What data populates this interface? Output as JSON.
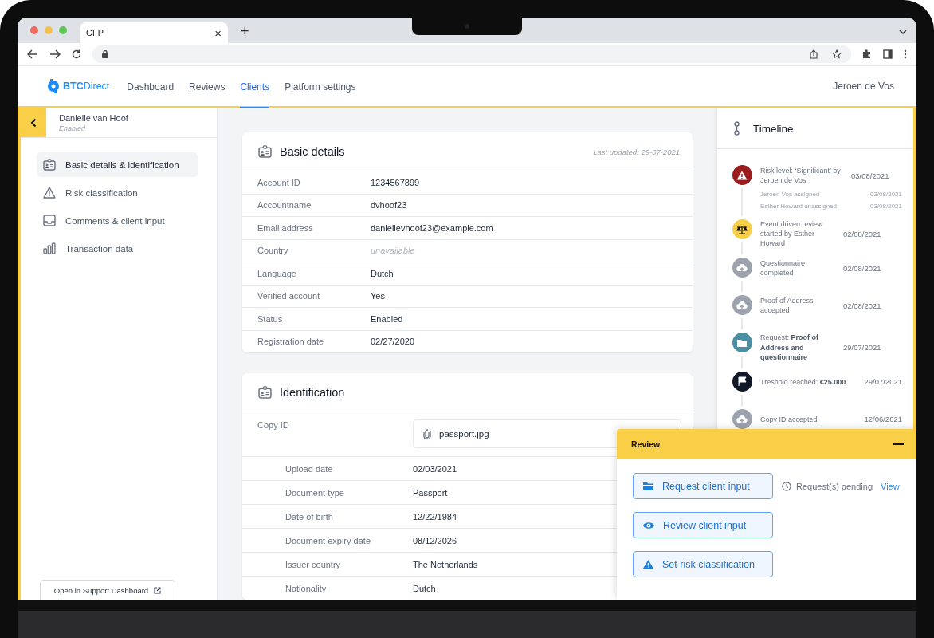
{
  "browser": {
    "tab_title": "CFP",
    "close_glyph": "×",
    "new_tab_glyph": "+"
  },
  "nav": {
    "brand": "BTC",
    "brand_suffix": "Direct",
    "user": "Jeroen de Vos",
    "items": [
      {
        "label": "Dashboard",
        "selected": false
      },
      {
        "label": "Reviews",
        "selected": false
      },
      {
        "label": "Clients",
        "selected": true
      },
      {
        "label": "Platform settings",
        "selected": false
      }
    ]
  },
  "client": {
    "name": "Danielle van Hoof",
    "status": "Enabled"
  },
  "sidebar": {
    "items": [
      {
        "label": "Basic details & identification",
        "selected": true
      },
      {
        "label": "Risk classification",
        "selected": false
      },
      {
        "label": "Comments & client input",
        "selected": false
      },
      {
        "label": "Transaction data",
        "selected": false
      }
    ],
    "support_link": "Open in Support Dashboard"
  },
  "basic_details": {
    "title": "Basic details",
    "last_updated": "Last updated: 29-07-2021",
    "rows": [
      {
        "label": "Account ID",
        "value": "1234567899",
        "unavailable": false
      },
      {
        "label": "Accountname",
        "value": "dvhoof23",
        "unavailable": false
      },
      {
        "label": "Email address",
        "value": "daniellevhoof23@example.com",
        "unavailable": false
      },
      {
        "label": "Country",
        "value": "unavailable",
        "unavailable": true
      },
      {
        "label": "Language",
        "value": "Dutch",
        "unavailable": false
      },
      {
        "label": "Verified account",
        "value": "Yes",
        "unavailable": false
      },
      {
        "label": "Status",
        "value": "Enabled",
        "unavailable": false
      },
      {
        "label": "Registration date",
        "value": "02/27/2020",
        "unavailable": false
      }
    ]
  },
  "identification": {
    "title": "Identification",
    "file_label": "Copy ID",
    "file_name": "passport.jpg",
    "rows": [
      {
        "label": "Upload date",
        "value": "02/03/2021"
      },
      {
        "label": "Document type",
        "value": "Passport"
      },
      {
        "label": "Date of birth",
        "value": "12/22/1984"
      },
      {
        "label": "Document expiry date",
        "value": "08/12/2026"
      },
      {
        "label": "Issuer country",
        "value": "The Netherlands"
      },
      {
        "label": "Nationality",
        "value": "Dutch"
      }
    ]
  },
  "timeline": {
    "title": "Timeline",
    "events": [
      {
        "kind": "risk",
        "color": "#9b1c1c",
        "text": "Risk level: ‘Significant’ by Jeroen de Vos",
        "date": "03/08/2021",
        "children": [
          {
            "text": "Jeroen Vos assigned",
            "date": "03/08/2021"
          },
          {
            "text": "Esther Howard unassigned",
            "date": "03/08/2021"
          }
        ]
      },
      {
        "kind": "review",
        "color": "#f9cf48",
        "text": "Event driven review started by Esther Howard",
        "date": "02/08/2021"
      },
      {
        "kind": "upload",
        "color": "#9ca3af",
        "text": "Questionnaire completed",
        "date": "02/08/2021"
      },
      {
        "kind": "upload",
        "color": "#9ca3af",
        "text": "Proof of Address accepted",
        "date": "02/08/2021"
      },
      {
        "kind": "request",
        "color": "#4a8fa3",
        "text": "Request: **Proof of Address and questionnaire**",
        "date": "29/07/2021"
      },
      {
        "kind": "threshold",
        "color": "#111827",
        "text": "Treshold reached: **€25.000**",
        "date": "29/07/2021"
      },
      {
        "kind": "upload",
        "color": "#9ca3af",
        "text": "Copy ID accepted",
        "date": "12/06/2021"
      }
    ]
  },
  "review": {
    "title": "Review",
    "buttons": [
      {
        "kind": "request",
        "label": "Request client input"
      },
      {
        "kind": "review",
        "label": "Review client input"
      },
      {
        "kind": "risk",
        "label": "Set risk classification"
      }
    ],
    "pending_text": "Request(s) pending",
    "pending_link": "View"
  }
}
